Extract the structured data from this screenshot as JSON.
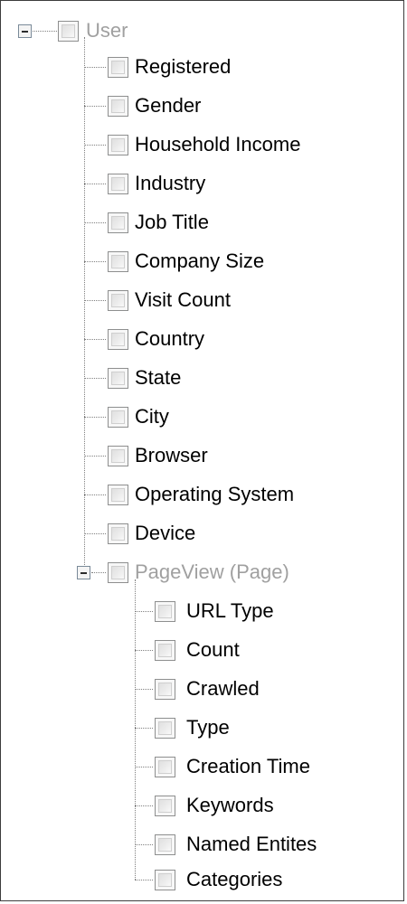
{
  "tree": {
    "root": {
      "label": "User",
      "expand_icon": "minus-icon",
      "children": [
        "Registered",
        "Gender",
        "Household Income",
        "Industry",
        "Job Title",
        "Company Size",
        "Visit Count",
        "Country",
        "State",
        "City",
        "Browser",
        "Operating System",
        "Device"
      ],
      "subgroup": {
        "label": "PageView (Page)",
        "expand_icon": "minus-icon",
        "children": [
          "URL Type",
          "Count",
          "Crawled",
          "Type",
          "Creation Time",
          "Keywords",
          "Named Entites",
          "Categories"
        ]
      }
    }
  },
  "colors": {
    "dim_text": "#a0a0a0",
    "text": "#000000",
    "frame": "#3c3c3c",
    "connector": "#808080"
  }
}
